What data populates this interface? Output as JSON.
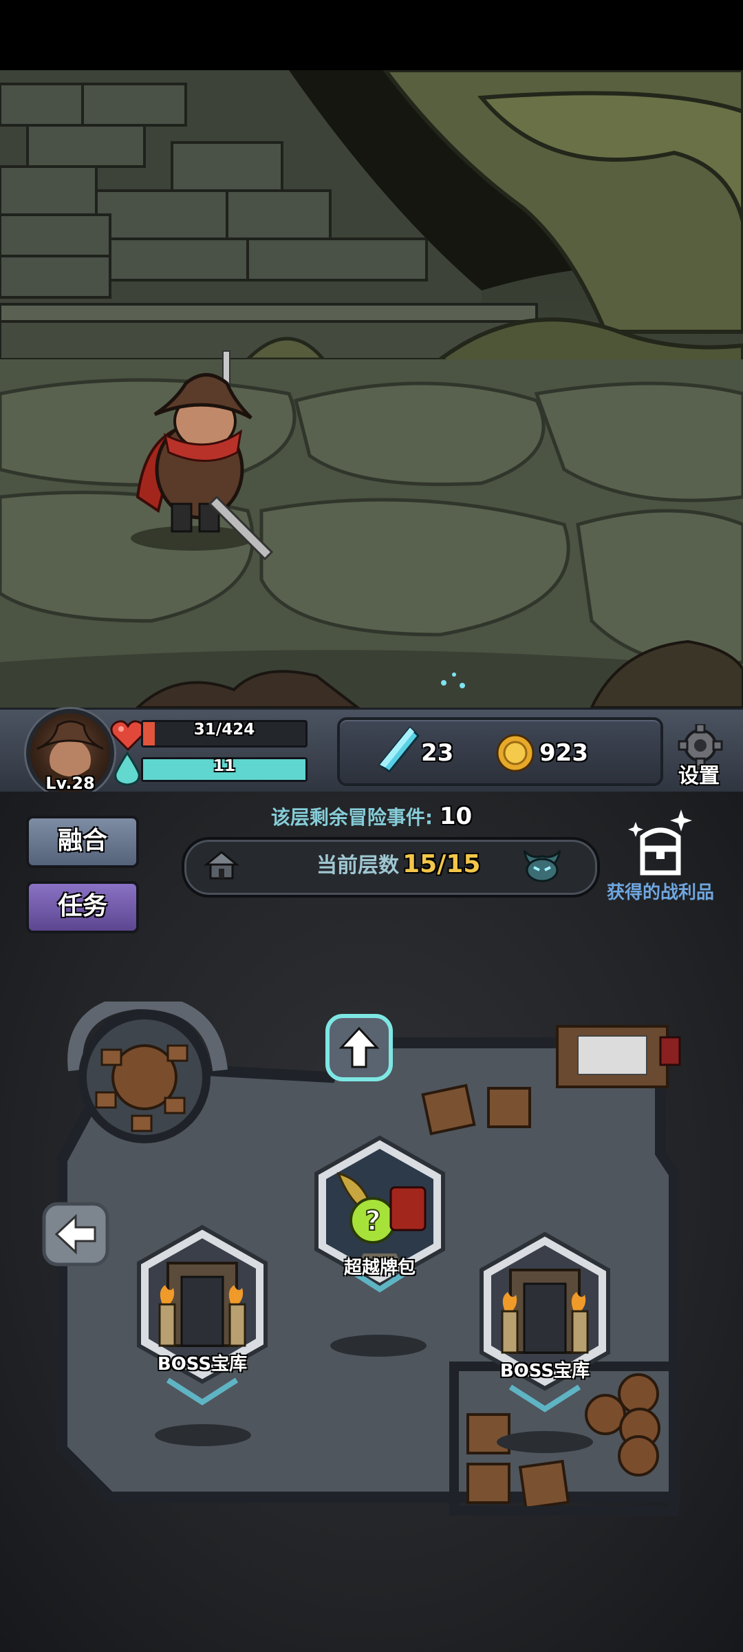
{
  "hud": {
    "level": "Lv.28",
    "hp_text": "31/424",
    "hp_fraction": 0.073,
    "mp_text": "11",
    "mp_fraction": 1.0,
    "gems": "23",
    "coins": "923",
    "settings_label": "设置"
  },
  "menu": {
    "fuse_label": "融合",
    "task_label": "任务"
  },
  "floor": {
    "events_label": "该层剩余冒险事件:",
    "events_count": "10",
    "current_label": "当前层数",
    "current_value": "15/15"
  },
  "loot": {
    "label": "获得的战利品"
  },
  "map": {
    "nodes": [
      {
        "label": "超越牌包"
      },
      {
        "label": "BOSS宝库"
      },
      {
        "label": "BOSS宝库"
      }
    ]
  },
  "colors": {
    "hp": "#e0553c",
    "mp": "#5fd6d0",
    "floor_value": "#f3c64a",
    "loot_text": "#6fa6df",
    "events_text": "#86cdd8"
  }
}
